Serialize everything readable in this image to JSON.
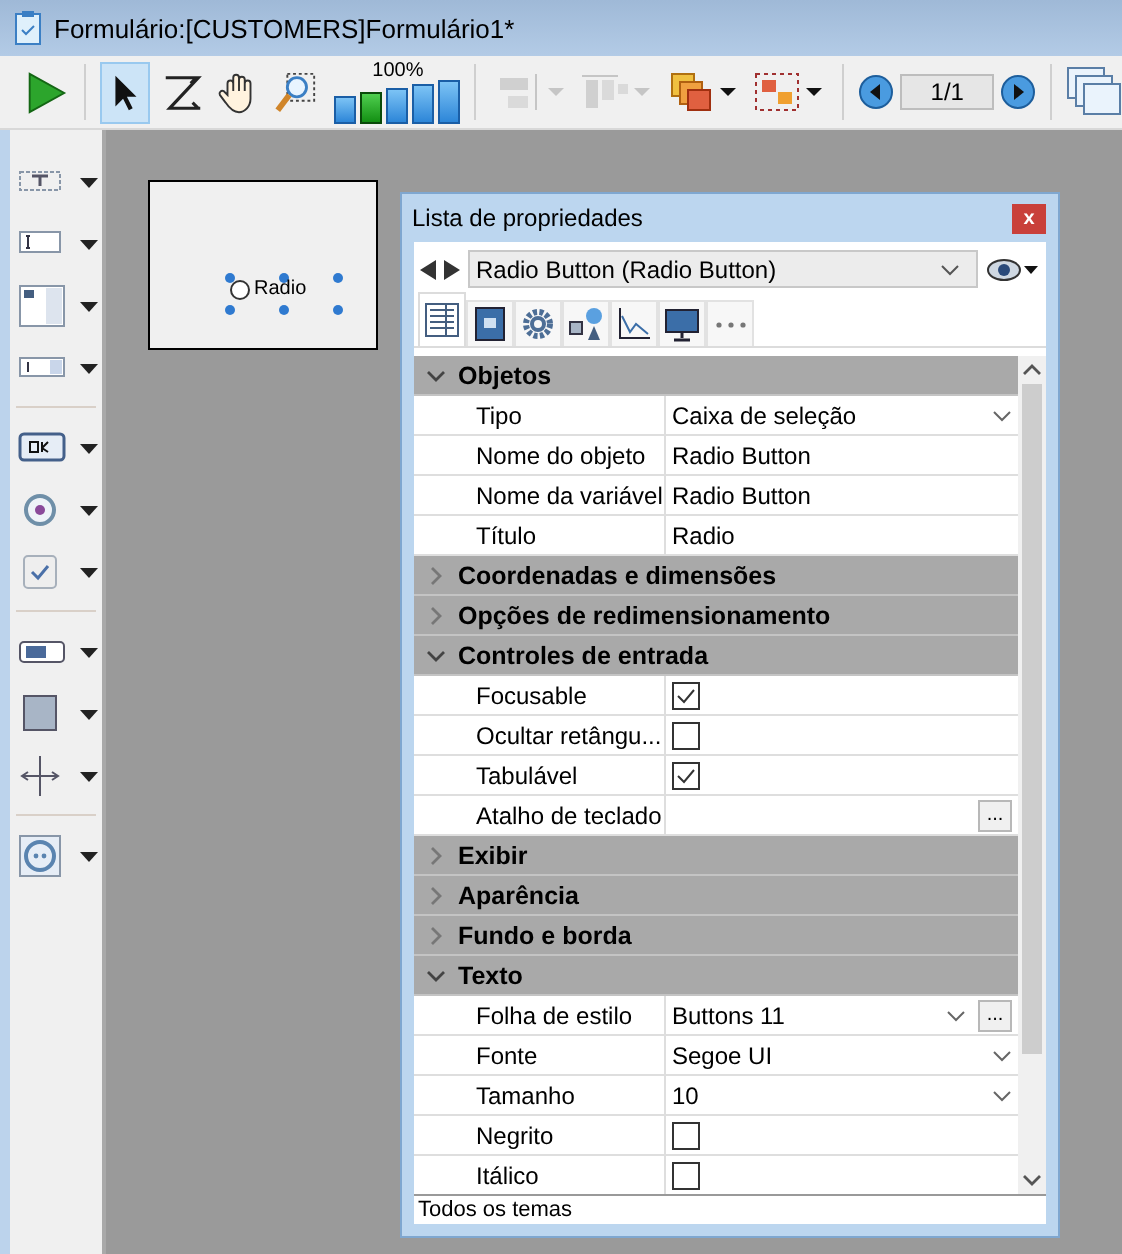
{
  "window": {
    "title": "Formulário:[CUSTOMERS]Formulário1*"
  },
  "toolbar": {
    "tools": [
      {
        "kind": "run",
        "selected": false,
        "disabled": false
      },
      {
        "kind": "pointer",
        "selected": true,
        "disabled": false
      },
      {
        "kind": "entry-order",
        "selected": false,
        "disabled": false
      },
      {
        "kind": "hand",
        "selected": false,
        "disabled": false
      },
      {
        "kind": "zoom",
        "selected": false,
        "disabled": false
      }
    ],
    "zoom": {
      "label": "100%",
      "levels": [
        {
          "selected": false
        },
        {
          "selected": true
        },
        {
          "selected": false
        },
        {
          "selected": false
        },
        {
          "selected": false
        }
      ]
    },
    "arrange": [
      {
        "kind": "align",
        "disabled": true
      },
      {
        "kind": "distribute",
        "disabled": true
      },
      {
        "kind": "layer",
        "disabled": false
      },
      {
        "kind": "group",
        "disabled": false
      }
    ],
    "page_indicator": "1/1"
  },
  "object_palette": [
    {
      "kind": "text"
    },
    {
      "kind": "input"
    },
    {
      "kind": "list"
    },
    {
      "kind": "combo"
    },
    {
      "kind": "separator"
    },
    {
      "kind": "button"
    },
    {
      "kind": "radio"
    },
    {
      "kind": "checkbox"
    },
    {
      "kind": "separator"
    },
    {
      "kind": "progress"
    },
    {
      "kind": "rectangle"
    },
    {
      "kind": "splitter"
    },
    {
      "kind": "separator"
    },
    {
      "kind": "subform"
    }
  ],
  "form_preview": {
    "radio_label": "Radio",
    "selected": false
  },
  "property_list": {
    "title": "Lista de propriedades",
    "close": "x",
    "object": "Radio Button (Radio Button)",
    "tabs": [
      {
        "kind": "list",
        "selected": true
      },
      {
        "kind": "form",
        "selected": false
      },
      {
        "kind": "gear",
        "selected": false
      },
      {
        "kind": "shapes",
        "selected": false
      },
      {
        "kind": "chart",
        "selected": false
      },
      {
        "kind": "monitor",
        "selected": false
      },
      {
        "kind": "more",
        "selected": false
      }
    ],
    "sections": [
      {
        "title": "Objetos",
        "expanded": true,
        "rows": [
          {
            "label": "Tipo",
            "kind": "dropdown",
            "value": "Caixa de seleção"
          },
          {
            "label": "Nome do objeto",
            "kind": "text",
            "value": "Radio Button"
          },
          {
            "label": "Nome da variável",
            "kind": "text",
            "value": "Radio Button"
          },
          {
            "label": "Título",
            "kind": "text",
            "value": "Radio"
          }
        ]
      },
      {
        "title": "Coordenadas e dimensões",
        "expanded": false
      },
      {
        "title": "Opções de redimensionamento",
        "expanded": false
      },
      {
        "title": "Controles de entrada",
        "expanded": true,
        "rows": [
          {
            "label": "Focusable",
            "kind": "checkbox",
            "checked": true
          },
          {
            "label": "Ocultar retângu...",
            "kind": "checkbox",
            "checked": false
          },
          {
            "label": "Tabulável",
            "kind": "checkbox",
            "checked": true
          },
          {
            "label": "Atalho de teclado",
            "kind": "button",
            "value": "..."
          }
        ]
      },
      {
        "title": "Exibir",
        "expanded": false
      },
      {
        "title": "Aparência",
        "expanded": false
      },
      {
        "title": "Fundo e borda",
        "expanded": false
      },
      {
        "title": "Texto",
        "expanded": true,
        "rows": [
          {
            "label": "Folha de estilo",
            "kind": "dropdown-button",
            "value": "Buttons 11",
            "button": "..."
          },
          {
            "label": "Fonte",
            "kind": "dropdown",
            "value": "Segoe UI"
          },
          {
            "label": "Tamanho",
            "kind": "dropdown",
            "value": "10"
          },
          {
            "label": "Negrito",
            "kind": "checkbox",
            "checked": false
          },
          {
            "label": "Itálico",
            "kind": "checkbox",
            "checked": false
          }
        ]
      }
    ],
    "status": "Todos os temas"
  }
}
